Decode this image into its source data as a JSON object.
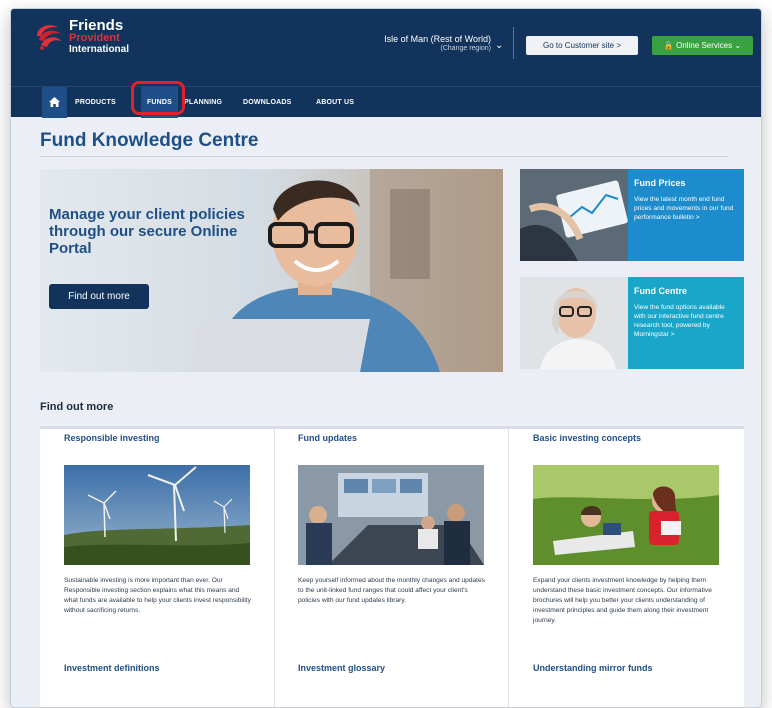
{
  "brand": {
    "line1": "Friends",
    "line2": "Provident",
    "line3": "International"
  },
  "header": {
    "region_name": "Isle of Man (Rest of World)",
    "region_change": "(Change region)",
    "customer_site_label": "Go to Customer site  >",
    "online_services_label": "Online Services",
    "colors": {
      "navy": "#11335c",
      "green": "#3aa142",
      "highlight": "#e0222d"
    }
  },
  "nav": {
    "items": [
      {
        "label": "PRODUCTS"
      },
      {
        "label": "FUNDS"
      },
      {
        "label": "PLANNING"
      },
      {
        "label": "DOWNLOADS"
      },
      {
        "label": "ABOUT US"
      }
    ]
  },
  "page": {
    "title": "Fund Knowledge Centre"
  },
  "hero": {
    "headline": "Manage your client policies through our secure Online Portal",
    "button_label": "Find out more"
  },
  "side_cards": [
    {
      "title": "Fund Prices",
      "description": "View the latest month end fund prices and movements in our fund performance bulletin  >"
    },
    {
      "title": "Fund Centre",
      "description": "View the fund options available with our interactive fund centre research tool, powered by Morningstar  >"
    }
  ],
  "find_out_more": {
    "heading": "Find out more",
    "cards": [
      {
        "title": "Responsible investing",
        "text": "Sustainable investing is more important than ever. Our Responsible investing section explains what this means and what funds are available to help your clients invest responsibility without sacrificing returns.",
        "next_title": "Investment definitions"
      },
      {
        "title": "Fund updates",
        "text": "Keep yourself informed about the monthly changes and updates to the unit-linked fund ranges that could affect your client's policies with our fund updates library.",
        "next_title": "Investment glossary"
      },
      {
        "title": "Basic investing concepts",
        "text": "Expand your clients investment knowledge by helping them understand these basic investment concepts. Our informative brochures will help you better your clients understanding of investment principles and guide them along their investment journey.",
        "next_title": "Understanding mirror funds"
      }
    ]
  }
}
